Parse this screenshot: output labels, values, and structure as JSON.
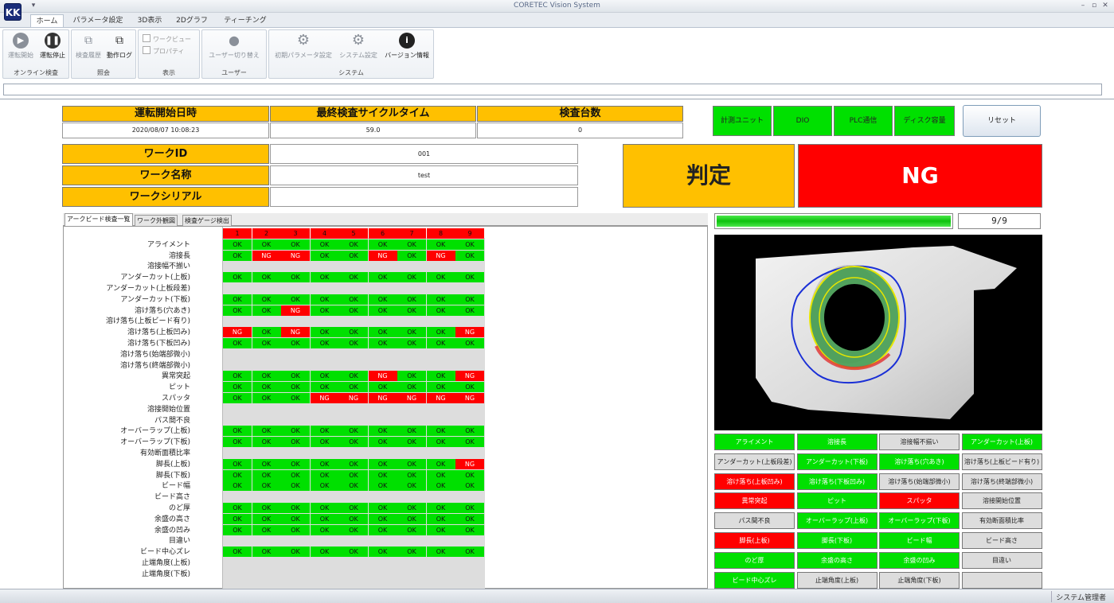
{
  "window": {
    "title": "CORETEC Vision System",
    "logo": "KK"
  },
  "ribbon_tabs": [
    "ホーム",
    "パラメータ設定",
    "3D表示",
    "2Dグラフ",
    "ティーチング"
  ],
  "ribbon": {
    "online": {
      "label": "オンライン検査",
      "start": "運転開始",
      "stop": "運転停止"
    },
    "history": {
      "label": "照会",
      "inspection": "検査履歴",
      "operation": "動作ログ"
    },
    "view": {
      "label": "表示",
      "workview": "ワークビュー",
      "property": "プロパティ"
    },
    "user": {
      "label": "ユーザー",
      "switch": "ユーザー切り替え"
    },
    "system": {
      "label": "システム",
      "init_param": "初期パラメータ設定",
      "sys_setting": "システム設定",
      "version": "バージョン情報"
    }
  },
  "summary": {
    "start_time_label": "運転開始日時",
    "start_time": "2020/08/07 10:08:23",
    "cycle_label": "最終検査サイクルタイム",
    "cycle": "59.0",
    "count_label": "検査台数",
    "count": "0",
    "work_id_label": "ワークID",
    "work_id": "001",
    "work_name_label": "ワーク名称",
    "work_name": "test",
    "work_serial_label": "ワークシリアル",
    "work_serial": ""
  },
  "status_boxes": [
    "計測ユニット",
    "DIO",
    "PLC通信",
    "ディスク容量"
  ],
  "reset_label": "リセット",
  "judge": {
    "label": "判定",
    "value": "NG"
  },
  "detail_tabs": [
    "アークビード検査一覧",
    "ワーク外観図",
    "検査ゲージ検出"
  ],
  "progress": {
    "text": "9/9",
    "fraction": 1.0
  },
  "grid": {
    "columns": [
      "1",
      "2",
      "3",
      "4",
      "5",
      "6",
      "7",
      "8",
      "9"
    ],
    "rows": [
      {
        "label": "アライメント",
        "v": [
          "OK",
          "OK",
          "OK",
          "OK",
          "OK",
          "OK",
          "OK",
          "OK",
          "OK"
        ]
      },
      {
        "label": "溶接長",
        "v": [
          "OK",
          "NG",
          "NG",
          "OK",
          "OK",
          "NG",
          "OK",
          "NG",
          "OK"
        ]
      },
      {
        "label": "溶接幅不揃い",
        "v": []
      },
      {
        "label": "アンダーカット(上板)",
        "v": [
          "OK",
          "OK",
          "OK",
          "OK",
          "OK",
          "OK",
          "OK",
          "OK",
          "OK"
        ]
      },
      {
        "label": "アンダーカット(上板段差)",
        "v": []
      },
      {
        "label": "アンダーカット(下板)",
        "v": [
          "OK",
          "OK",
          "OK",
          "OK",
          "OK",
          "OK",
          "OK",
          "OK",
          "OK"
        ]
      },
      {
        "label": "溶け落ち(穴あき)",
        "v": [
          "OK",
          "OK",
          "NG",
          "OK",
          "OK",
          "OK",
          "OK",
          "OK",
          "OK"
        ]
      },
      {
        "label": "溶け落ち(上板ビード有り)",
        "v": []
      },
      {
        "label": "溶け落ち(上板凹み)",
        "v": [
          "NG",
          "OK",
          "NG",
          "OK",
          "OK",
          "OK",
          "OK",
          "OK",
          "NG"
        ]
      },
      {
        "label": "溶け落ち(下板凹み)",
        "v": [
          "OK",
          "OK",
          "OK",
          "OK",
          "OK",
          "OK",
          "OK",
          "OK",
          "OK"
        ]
      },
      {
        "label": "溶け落ち(始端部微小)",
        "v": []
      },
      {
        "label": "溶け落ち(終端部微小)",
        "v": []
      },
      {
        "label": "異常突起",
        "v": [
          "OK",
          "OK",
          "OK",
          "OK",
          "OK",
          "NG",
          "OK",
          "OK",
          "NG"
        ]
      },
      {
        "label": "ピット",
        "v": [
          "OK",
          "OK",
          "OK",
          "OK",
          "OK",
          "OK",
          "OK",
          "OK",
          "OK"
        ]
      },
      {
        "label": "スパッタ",
        "v": [
          "OK",
          "OK",
          "OK",
          "NG",
          "NG",
          "NG",
          "NG",
          "NG",
          "NG"
        ]
      },
      {
        "label": "溶接開始位置",
        "v": []
      },
      {
        "label": "パス間不良",
        "v": []
      },
      {
        "label": "オーバーラップ(上板)",
        "v": [
          "OK",
          "OK",
          "OK",
          "OK",
          "OK",
          "OK",
          "OK",
          "OK",
          "OK"
        ]
      },
      {
        "label": "オーバーラップ(下板)",
        "v": [
          "OK",
          "OK",
          "OK",
          "OK",
          "OK",
          "OK",
          "OK",
          "OK",
          "OK"
        ]
      },
      {
        "label": "有効断面積比率",
        "v": []
      },
      {
        "label": "脚長(上板)",
        "v": [
          "OK",
          "OK",
          "OK",
          "OK",
          "OK",
          "OK",
          "OK",
          "OK",
          "NG"
        ]
      },
      {
        "label": "脚長(下板)",
        "v": [
          "OK",
          "OK",
          "OK",
          "OK",
          "OK",
          "OK",
          "OK",
          "OK",
          "OK"
        ]
      },
      {
        "label": "ビード幅",
        "v": [
          "OK",
          "OK",
          "OK",
          "OK",
          "OK",
          "OK",
          "OK",
          "OK",
          "OK"
        ]
      },
      {
        "label": "ビード高さ",
        "v": []
      },
      {
        "label": "のど厚",
        "v": [
          "OK",
          "OK",
          "OK",
          "OK",
          "OK",
          "OK",
          "OK",
          "OK",
          "OK"
        ]
      },
      {
        "label": "余盛の高さ",
        "v": [
          "OK",
          "OK",
          "OK",
          "OK",
          "OK",
          "OK",
          "OK",
          "OK",
          "OK"
        ]
      },
      {
        "label": "余盛の凹み",
        "v": [
          "OK",
          "OK",
          "OK",
          "OK",
          "OK",
          "OK",
          "OK",
          "OK",
          "OK"
        ]
      },
      {
        "label": "目違い",
        "v": []
      },
      {
        "label": "ビード中心ズレ",
        "v": [
          "OK",
          "OK",
          "OK",
          "OK",
          "OK",
          "OK",
          "OK",
          "OK",
          "OK"
        ]
      },
      {
        "label": "止端角度(上板)",
        "v": []
      },
      {
        "label": "止端角度(下板)",
        "v": []
      }
    ]
  },
  "result_buttons": [
    {
      "label": "アライメント",
      "state": "ok"
    },
    {
      "label": "溶接長",
      "state": "ok"
    },
    {
      "label": "溶接幅不揃い",
      "state": "none"
    },
    {
      "label": "アンダーカット(上板)",
      "state": "ok"
    },
    {
      "label": "アンダーカット(上板段差)",
      "state": "none"
    },
    {
      "label": "アンダーカット(下板)",
      "state": "ok"
    },
    {
      "label": "溶け落ち(穴あき)",
      "state": "ok"
    },
    {
      "label": "溶け落ち(上板ビード有り)",
      "state": "none"
    },
    {
      "label": "溶け落ち(上板凹み)",
      "state": "ng"
    },
    {
      "label": "溶け落ち(下板凹み)",
      "state": "ok"
    },
    {
      "label": "溶け落ち(始端部微小)",
      "state": "none"
    },
    {
      "label": "溶け落ち(終端部微小)",
      "state": "none"
    },
    {
      "label": "異常突起",
      "state": "ng"
    },
    {
      "label": "ピット",
      "state": "ok"
    },
    {
      "label": "スパッタ",
      "state": "ng"
    },
    {
      "label": "溶接開始位置",
      "state": "none"
    },
    {
      "label": "パス間不良",
      "state": "none"
    },
    {
      "label": "オーバーラップ(上板)",
      "state": "ok"
    },
    {
      "label": "オーバーラップ(下板)",
      "state": "ok"
    },
    {
      "label": "有効断面積比率",
      "state": "none"
    },
    {
      "label": "脚長(上板)",
      "state": "ng"
    },
    {
      "label": "脚長(下板)",
      "state": "ok"
    },
    {
      "label": "ビード幅",
      "state": "ok"
    },
    {
      "label": "ビード高さ",
      "state": "none"
    },
    {
      "label": "のど厚",
      "state": "ok"
    },
    {
      "label": "余盛の高さ",
      "state": "ok"
    },
    {
      "label": "余盛の凹み",
      "state": "ok"
    },
    {
      "label": "目違い",
      "state": "none"
    },
    {
      "label": "ビード中心ズレ",
      "state": "ok"
    },
    {
      "label": "止端角度(上板)",
      "state": "none"
    },
    {
      "label": "止端角度(下板)",
      "state": "none"
    },
    {
      "label": "",
      "state": "none"
    }
  ],
  "colors": {
    "ok": "#00e000",
    "ng": "#ff0000",
    "none": "#dddddd",
    "header": "#ffc000"
  },
  "status_user": "システム管理者"
}
